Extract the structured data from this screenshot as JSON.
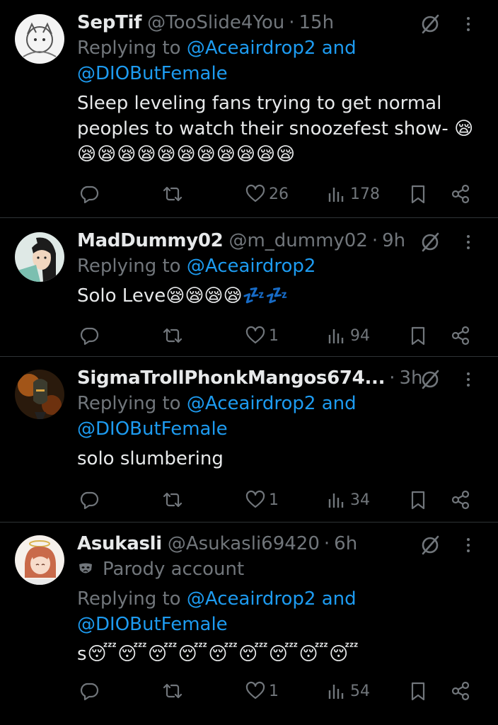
{
  "tweets": [
    {
      "name": "SepTif",
      "handle": "@TooSlide4You",
      "dot": "·",
      "time": "15h",
      "reply_prefix": "Replying to",
      "mentions_line1": "@Aceairdrop2 and",
      "mentions_line2": "@DIOButFemale",
      "text_line1": "Sleep leveling fans trying to get normal",
      "text_line2": "peoples to watch their snoozefest show- 😪",
      "text_line3": "😪😪😪😪😪😪😪😪😪😪😪",
      "replies": "",
      "reposts": "",
      "likes": "26",
      "views": "178"
    },
    {
      "name": "MadDummy02",
      "handle": "@m_dummy02",
      "dot": "·",
      "time": "9h",
      "reply_prefix": "Replying to",
      "mentions_line1": "@Aceairdrop2",
      "text_line1": "Solo Leve😪😪😪😪💤💤",
      "likes": "1",
      "views": "94"
    },
    {
      "name": "SigmaTrollPhonkMangos674...",
      "dot": "·",
      "time": "3h",
      "reply_prefix": "Replying to",
      "mentions_line1": "@Aceairdrop2 and",
      "mentions_line2": "@DIOButFemale",
      "text_line1": "solo slumbering",
      "likes": "1",
      "views": "34"
    },
    {
      "name": "Asukasli",
      "handle": "@Asukasli69420",
      "dot": "·",
      "time": "6h",
      "parody_label": "Parody account",
      "reply_prefix": "Replying to",
      "mentions_line1": "@Aceairdrop2 and",
      "mentions_line2": "@DIOButFemale",
      "text_line1": "s😴😴😴😴😴😴😴😴😴",
      "likes": "1",
      "views": "54"
    }
  ],
  "colors": {
    "background": "#000000",
    "text": "#e7e9ea",
    "muted": "#71767b",
    "link": "#1d9bf0",
    "divider": "#2f3336"
  },
  "icons": [
    "reply-icon",
    "repost-icon",
    "like-icon",
    "views-icon",
    "bookmark-icon",
    "share-icon",
    "grok-icon",
    "more-icon",
    "parody-mask-icon"
  ]
}
